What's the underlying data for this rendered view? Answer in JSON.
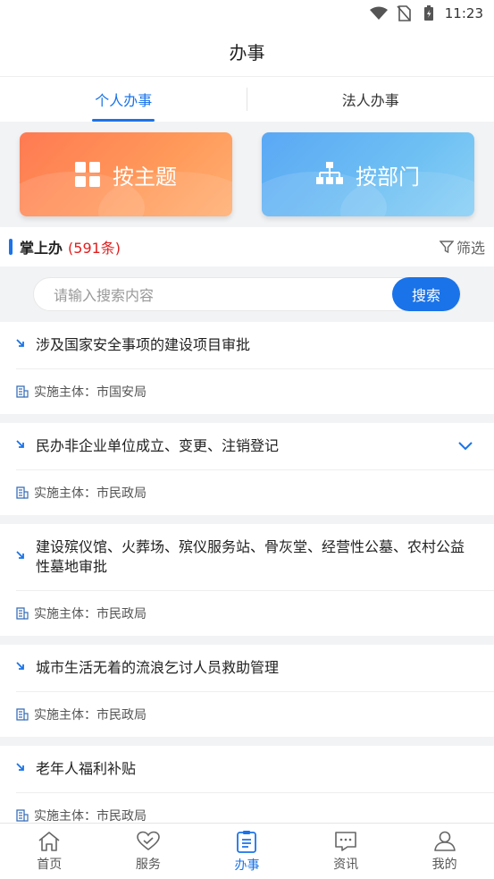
{
  "status": {
    "time": "11:23"
  },
  "header": {
    "title": "办事"
  },
  "tabs": [
    {
      "label": "个人办事",
      "active": true
    },
    {
      "label": "法人办事",
      "active": false
    }
  ],
  "categories": [
    {
      "label": "按主题",
      "icon": "grid-icon"
    },
    {
      "label": "按部门",
      "icon": "org-chart-icon"
    }
  ],
  "section": {
    "title": "掌上办",
    "count": "(591条)",
    "filter_label": "筛选"
  },
  "search": {
    "placeholder": "请输入搜索内容",
    "button_label": "搜索"
  },
  "items": [
    {
      "title": "涉及国家安全事项的建设项目审批",
      "label": "实施主体：",
      "org": "市国安局"
    },
    {
      "title": "民办非企业单位成立、变更、注销登记",
      "label": "实施主体：",
      "org": "市民政局"
    },
    {
      "title": "建设殡仪馆、火葬场、殡仪服务站、骨灰堂、经营性公墓、农村公益性墓地审批",
      "label": "实施主体：",
      "org": "市民政局"
    },
    {
      "title": "城市生活无着的流浪乞讨人员救助管理",
      "label": "实施主体：",
      "org": "市民政局"
    },
    {
      "title": "老年人福利补贴",
      "label": "实施主体：",
      "org": "市民政局"
    }
  ],
  "bottom_nav": [
    {
      "label": "首页",
      "icon": "home-icon"
    },
    {
      "label": "服务",
      "icon": "heart-hand-icon"
    },
    {
      "label": "办事",
      "icon": "clipboard-icon",
      "active": true
    },
    {
      "label": "资讯",
      "icon": "message-icon"
    },
    {
      "label": "我的",
      "icon": "user-icon"
    }
  ],
  "colors": {
    "accent": "#1a73e8",
    "count_red": "#e02020"
  }
}
